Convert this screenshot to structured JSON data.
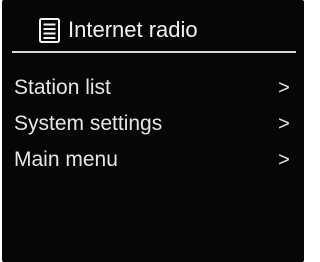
{
  "header": {
    "icon": "list-document-icon",
    "title": "Internet radio"
  },
  "menu": {
    "items": [
      {
        "label": "Station list",
        "arrow": ">"
      },
      {
        "label": "System settings",
        "arrow": ">"
      },
      {
        "label": "Main menu",
        "arrow": ">"
      }
    ]
  },
  "colors": {
    "background": "#060606",
    "text": "#e8e8e8",
    "divider": "#d8d8d8"
  }
}
